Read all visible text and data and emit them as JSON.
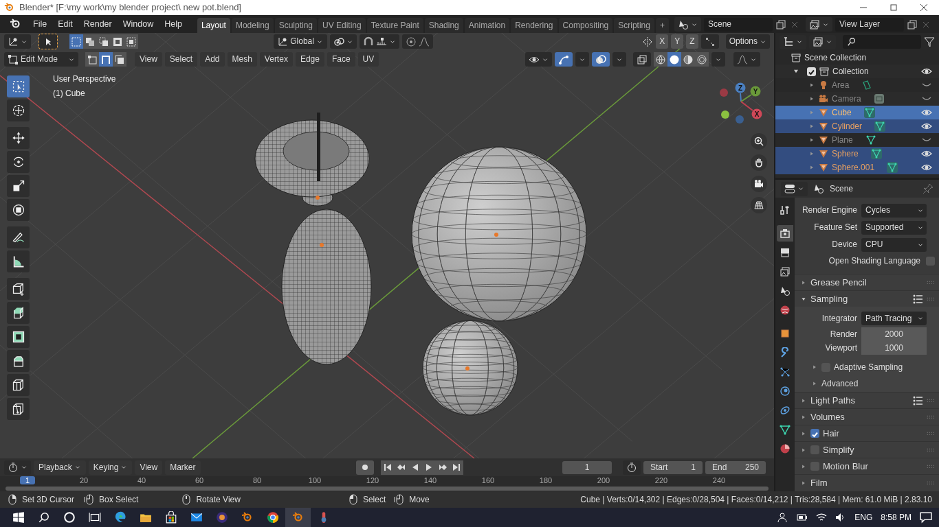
{
  "title_bar": {
    "title": "Blender* [F:\\my work\\my blender project\\ new pot.blend]"
  },
  "menu": [
    "File",
    "Edit",
    "Render",
    "Window",
    "Help"
  ],
  "workspaces": [
    {
      "label": "Layout",
      "selected": true
    },
    {
      "label": "Modeling",
      "selected": false
    },
    {
      "label": "Sculpting",
      "selected": false
    },
    {
      "label": "UV Editing",
      "selected": false
    },
    {
      "label": "Texture Paint",
      "selected": false
    },
    {
      "label": "Shading",
      "selected": false
    },
    {
      "label": "Animation",
      "selected": false
    },
    {
      "label": "Rendering",
      "selected": false
    },
    {
      "label": "Compositing",
      "selected": false
    },
    {
      "label": "Scripting",
      "selected": false
    }
  ],
  "add_workspace": "+",
  "scene": "Scene",
  "view_layer": "View Layer",
  "tool_header": {
    "box_modes": [
      {
        "selected": true
      },
      {
        "selected": false
      },
      {
        "selected": false
      },
      {
        "selected": false
      },
      {
        "selected": false
      }
    ],
    "orientation": "Global",
    "axes": [
      "X",
      "Y",
      "Z"
    ],
    "options": "Options"
  },
  "viewport_header": {
    "mode": "Edit Mode",
    "select_modes": [
      {
        "selected": false
      },
      {
        "selected": true
      },
      {
        "selected": false
      }
    ],
    "menus": [
      "View",
      "Select",
      "Add",
      "Mesh",
      "Vertex",
      "Edge",
      "Face",
      "UV"
    ],
    "gizmos_on": true,
    "overlays_on": true,
    "shading_modes": [
      {
        "selected": false
      },
      {
        "selected": true
      },
      {
        "selected": false
      },
      {
        "selected": false
      }
    ]
  },
  "viewport": {
    "view_name": "User Perspective",
    "object_name": "(1) Cube",
    "tools": [
      {
        "selected": true
      },
      {
        "selected": false
      },
      {
        "selected": false
      },
      {
        "selected": false
      },
      {
        "selected": false
      },
      {
        "selected": false
      },
      {
        "selected": false
      },
      {
        "selected": false
      },
      {
        "selected": false
      },
      {
        "selected": false
      },
      {
        "selected": false
      },
      {
        "selected": false
      },
      {
        "selected": false
      },
      {
        "selected": false
      }
    ],
    "gizmo_axes": [
      "Z",
      "Y",
      "X"
    ]
  },
  "outliner": {
    "root": "Scene Collection",
    "collection": {
      "label": "Collection",
      "checked": true,
      "expanded": true,
      "visible": true,
      "children": [
        {
          "label": "Area",
          "kind": "light",
          "selected": false,
          "active": false,
          "visible": false
        },
        {
          "label": "Camera",
          "kind": "camera",
          "selected": false,
          "active": false,
          "visible": false
        },
        {
          "label": "Cube",
          "kind": "mesh",
          "selected": true,
          "active": true,
          "visible": true
        },
        {
          "label": "Cylinder",
          "kind": "mesh",
          "selected": true,
          "active": false,
          "visible": true
        },
        {
          "label": "Plane",
          "kind": "mesh",
          "selected": false,
          "active": false,
          "visible": false
        },
        {
          "label": "Sphere",
          "kind": "mesh",
          "selected": true,
          "active": false,
          "visible": true
        },
        {
          "label": "Sphere.001",
          "kind": "mesh",
          "selected": true,
          "active": false,
          "visible": true
        }
      ]
    }
  },
  "properties": {
    "context": "Scene",
    "tabs": [
      {
        "selected": false
      },
      {
        "selected": true
      },
      {
        "selected": false
      },
      {
        "selected": false
      },
      {
        "selected": false
      },
      {
        "selected": false
      },
      {
        "selected": false
      },
      {
        "selected": false
      },
      {
        "selected": false
      },
      {
        "selected": false
      },
      {
        "selected": false
      },
      {
        "selected": false
      },
      {
        "selected": false
      }
    ],
    "rows": [
      {
        "kind": "select",
        "label": "Render Engine",
        "value": "Cycles"
      },
      {
        "kind": "select",
        "label": "Feature Set",
        "value": "Supported"
      },
      {
        "kind": "select",
        "label": "Device",
        "value": "CPU"
      },
      {
        "kind": "checkbox",
        "label": "Open Shading Language",
        "checked": false
      },
      {
        "kind": "panel",
        "label": "Grease Pencil",
        "expanded": false,
        "presets": false
      },
      {
        "kind": "panel",
        "label": "Sampling",
        "expanded": true,
        "presets": true
      },
      {
        "kind": "select",
        "label": "Integrator",
        "value": "Path Tracing"
      },
      {
        "kind": "number",
        "label": "Render",
        "value": "2000"
      },
      {
        "kind": "number",
        "label": "Viewport",
        "value": "1000"
      },
      {
        "kind": "subpanel",
        "label": "Adaptive Sampling",
        "checked": false
      },
      {
        "kind": "subpanel",
        "label": "Advanced"
      },
      {
        "kind": "panel",
        "label": "Light Paths",
        "expanded": false,
        "presets": true
      },
      {
        "kind": "panel",
        "label": "Volumes",
        "expanded": false,
        "presets": false
      },
      {
        "kind": "panel",
        "label": "Hair",
        "expanded": false,
        "presets": false,
        "checked": true
      },
      {
        "kind": "panel",
        "label": "Simplify",
        "expanded": false,
        "presets": false,
        "checked": false
      },
      {
        "kind": "panel",
        "label": "Motion Blur",
        "expanded": false,
        "presets": false,
        "checked": false
      },
      {
        "kind": "panel",
        "label": "Film",
        "expanded": false,
        "presets": false
      }
    ]
  },
  "timeline": {
    "menus": [
      "Playback",
      "Keying",
      "View",
      "Marker"
    ],
    "current_frame": "1",
    "start_label": "Start",
    "start": "1",
    "end_label": "End",
    "end": "250",
    "ruler": [
      "1",
      "20",
      "40",
      "60",
      "80",
      "100",
      "120",
      "140",
      "160",
      "180",
      "200",
      "220",
      "240"
    ]
  },
  "status_bar": {
    "hints": [
      {
        "kind": "right",
        "label": "Set 3D Cursor"
      },
      {
        "kind": "drag",
        "label": "Box Select"
      },
      {
        "kind": "middle",
        "label": "Rotate View"
      },
      {
        "kind": "left",
        "label": "Select"
      },
      {
        "kind": "drag",
        "label": "Move"
      }
    ],
    "stats": "Cube | Verts:0/14,302 | Edges:0/28,504 | Faces:0/14,212 | Tris:28,584 | Mem: 61.0 MiB | 2.83.10"
  },
  "taskbar": {
    "language": "ENG",
    "time": "8:58 PM"
  }
}
